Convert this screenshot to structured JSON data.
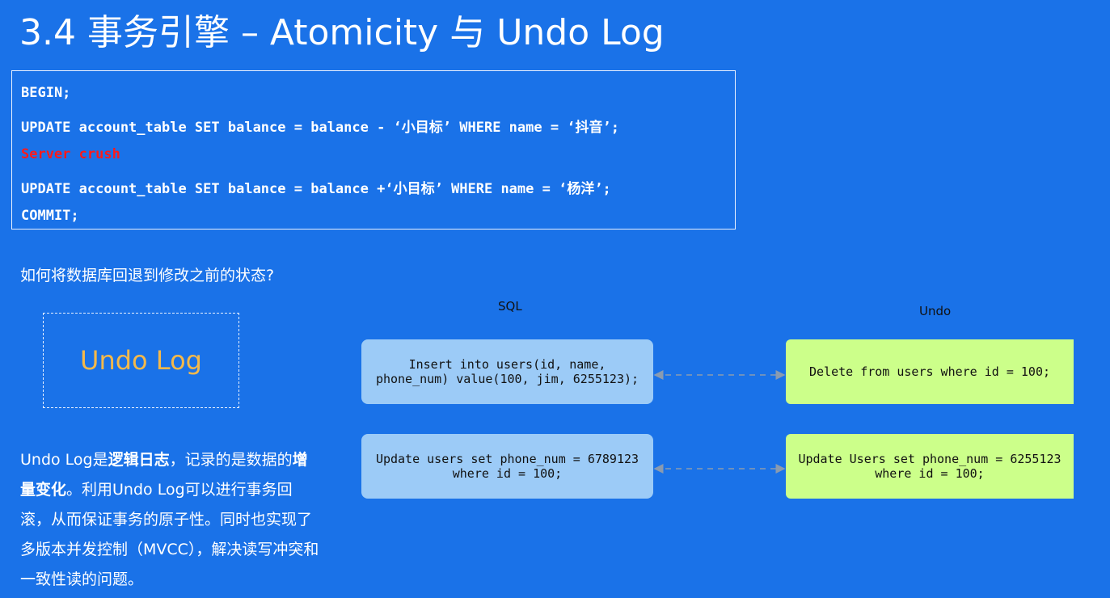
{
  "title": "3.4 事务引擎 –  Atomicity 与 Undo Log",
  "code": {
    "lines": [
      "BEGIN;",
      "UPDATE account_table SET balance = balance - ‘小目标’ WHERE name = ‘抖音’;",
      "Server crush",
      "UPDATE account_table SET balance = balance +‘小目标’ WHERE name = ‘杨洋’;",
      "COMMIT;"
    ],
    "error_color": "#ff1a1a"
  },
  "question": "如何将数据库回退到修改之前的状态?",
  "undo_log_label": "Undo Log",
  "description": {
    "p1": "Undo Log是",
    "b1": "逻辑日志",
    "p2": "，记录的是数据的",
    "b2": "增量变化",
    "p3": "。利用Undo Log可以进行事务回滚，从而保证事务的原子性。同时也实现了多版本并发控制（MVCC），解决读写冲突和一致性读的问题。"
  },
  "diagram": {
    "sql_label": "SQL",
    "undo_label": "Undo",
    "rows": [
      {
        "sql": "Insert into users(id, name,\nphone_num) value(100, jim, 6255123);",
        "undo": "Delete from users where id = 100;"
      },
      {
        "sql": "Update users set phone_num = 6789123\nwhere id = 100;",
        "undo": "Update Users set phone_num = 6255123\nwhere id = 100;"
      }
    ]
  },
  "colors": {
    "background": "#1a72e8",
    "sql_box": "#9ccbf7",
    "undo_box": "#ccff8a",
    "undo_log_text": "#f5b94a"
  }
}
